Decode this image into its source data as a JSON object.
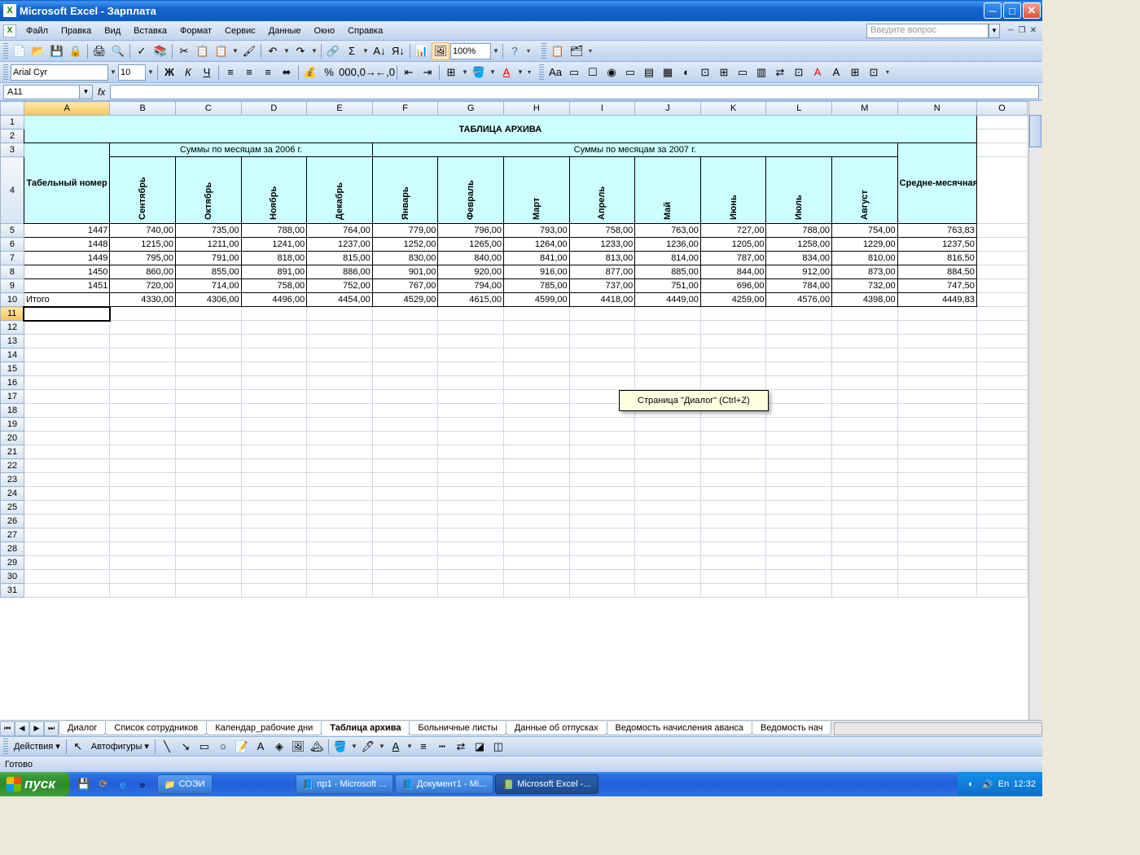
{
  "titlebar": {
    "app": "Microsoft Excel",
    "doc": "Зарплата"
  },
  "menu": {
    "file": "Файл",
    "edit": "Правка",
    "view": "Вид",
    "insert": "Вставка",
    "format": "Формат",
    "tools": "Сервис",
    "data": "Данные",
    "window": "Окно",
    "help": "Справка",
    "question_ph": "Введите вопрос"
  },
  "format_bar": {
    "font": "Arial Cyr",
    "size": "10",
    "zoom": "100%"
  },
  "formula": {
    "cell_ref": "A11",
    "value": ""
  },
  "columns": [
    "A",
    "B",
    "C",
    "D",
    "E",
    "F",
    "G",
    "H",
    "I",
    "J",
    "K",
    "L",
    "M",
    "N",
    "O"
  ],
  "table": {
    "title": "ТАБЛИЦА АРХИВА",
    "group_2006": "Суммы по месяцам за 2006 г.",
    "group_2007": "Суммы по месяцам за 2007 г.",
    "col_tab": "Табельный номер",
    "col_avg": "Средне-месячная",
    "months": [
      "Сентябрь",
      "Октябрь",
      "Ноябрь",
      "Декабрь",
      "Январь",
      "Февраль",
      "Март",
      "Апрель",
      "Май",
      "Июнь",
      "Июль",
      "Август"
    ],
    "rows": [
      {
        "id": "1447",
        "v": [
          "740,00",
          "735,00",
          "788,00",
          "764,00",
          "779,00",
          "796,00",
          "793,00",
          "758,00",
          "763,00",
          "727,00",
          "788,00",
          "754,00"
        ],
        "avg": "763,83"
      },
      {
        "id": "1448",
        "v": [
          "1215,00",
          "1211,00",
          "1241,00",
          "1237,00",
          "1252,00",
          "1265,00",
          "1264,00",
          "1233,00",
          "1236,00",
          "1205,00",
          "1258,00",
          "1229,00"
        ],
        "avg": "1237,50"
      },
      {
        "id": "1449",
        "v": [
          "795,00",
          "791,00",
          "818,00",
          "815,00",
          "830,00",
          "840,00",
          "841,00",
          "813,00",
          "814,00",
          "787,00",
          "834,00",
          "810,00"
        ],
        "avg": "816,50"
      },
      {
        "id": "1450",
        "v": [
          "860,00",
          "855,00",
          "891,00",
          "886,00",
          "901,00",
          "920,00",
          "916,00",
          "877,00",
          "885,00",
          "844,00",
          "912,00",
          "873,00"
        ],
        "avg": "884,50"
      },
      {
        "id": "1451",
        "v": [
          "720,00",
          "714,00",
          "758,00",
          "752,00",
          "767,00",
          "794,00",
          "785,00",
          "737,00",
          "751,00",
          "696,00",
          "784,00",
          "732,00"
        ],
        "avg": "747,50"
      }
    ],
    "total_label": "Итого",
    "totals": [
      "4330,00",
      "4306,00",
      "4496,00",
      "4454,00",
      "4529,00",
      "4615,00",
      "4599,00",
      "4418,00",
      "4449,00",
      "4259,00",
      "4576,00",
      "4398,00"
    ],
    "total_avg": "4449,83"
  },
  "tooltip": "Страница \"Диалог\" (Ctrl+Z)",
  "tabs": [
    "Диалог",
    "Список сотрудников",
    "Календар_рабочие дни",
    "Таблица архива",
    "Больничные листы",
    "Данные об отпусках",
    "Ведомость начисления аванса",
    "Ведомость нач"
  ],
  "active_tab": 3,
  "draw": {
    "actions": "Действия",
    "autoshapes": "Автофигуры"
  },
  "status": "Готово",
  "taskbar": {
    "start": "пуск",
    "folder": "СОЭИ",
    "tasks": [
      "пр1 - Microsoft ...",
      "Документ1 - Mi...",
      "Microsoft Excel -..."
    ],
    "lang": "En",
    "time": "12:32"
  }
}
